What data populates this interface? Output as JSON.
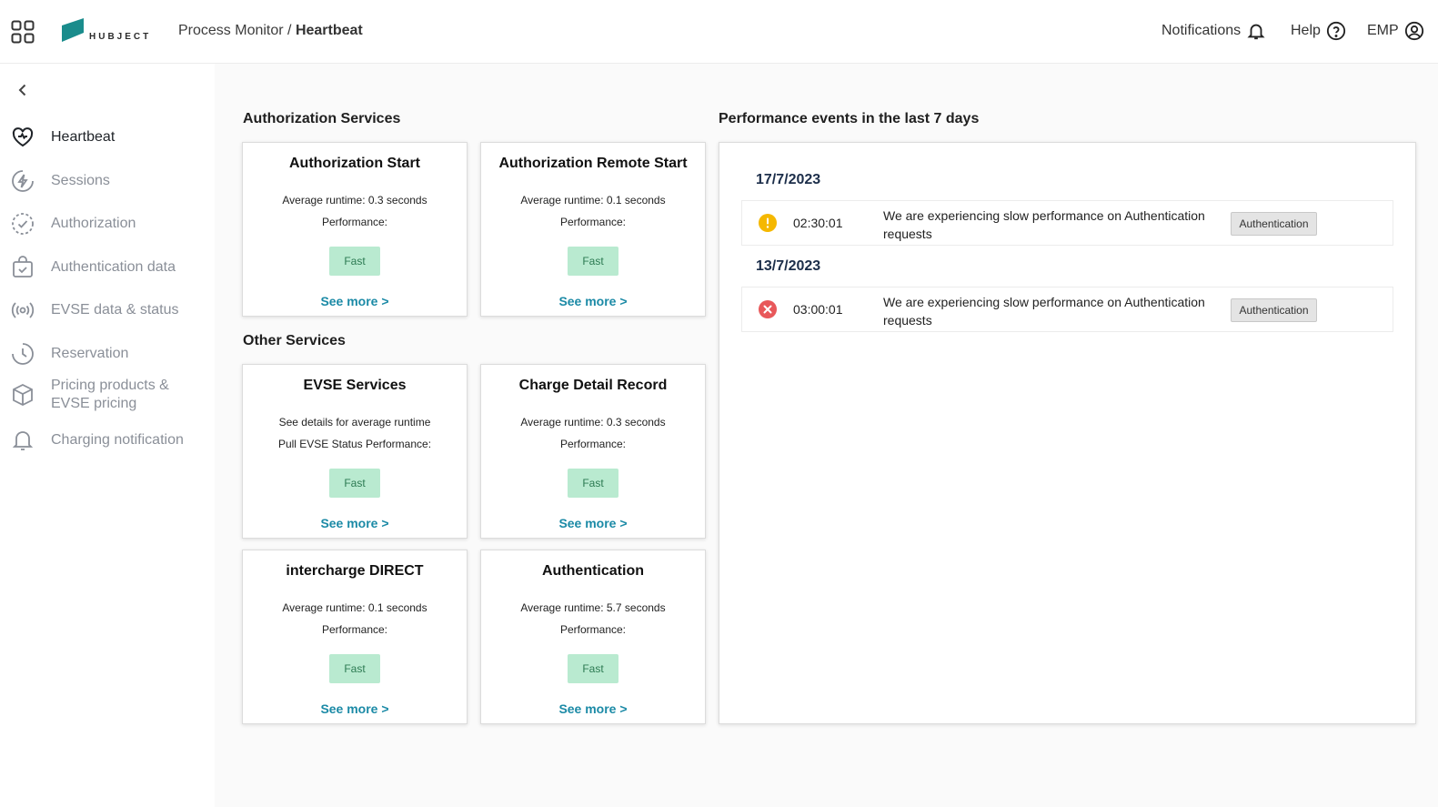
{
  "header": {
    "logo_text": "HUBJECT",
    "breadcrumb_parent": "Process Monitor / ",
    "breadcrumb_current": "Heartbeat",
    "notifications_label": "Notifications",
    "help_label": "Help",
    "account_label": "EMP"
  },
  "sidebar": {
    "items": [
      {
        "label": "Heartbeat",
        "icon": "heart-icon"
      },
      {
        "label": "Sessions",
        "icon": "bolt-icon"
      },
      {
        "label": "Authorization",
        "icon": "check-circle-icon"
      },
      {
        "label": "Authentication data",
        "icon": "bag-check-icon"
      },
      {
        "label": "EVSE data & status",
        "icon": "broadcast-icon"
      },
      {
        "label": "Reservation",
        "icon": "clock-icon"
      },
      {
        "label": "Pricing products &",
        "label2": "EVSE pricing",
        "icon": "box-icon"
      },
      {
        "label": "Charging notification",
        "icon": "bell-icon"
      }
    ]
  },
  "sections": {
    "authorization_title": "Authorization Services",
    "other_title": "Other Services",
    "events_title": "Performance events in the last 7 days"
  },
  "cards": [
    {
      "title": "Authorization Start",
      "line1": "Average runtime: 0.3 seconds",
      "line2": "Performance:",
      "status": "Fast",
      "link": "See more >"
    },
    {
      "title": "Authorization Remote Start",
      "line1": "Average runtime: 0.1 seconds",
      "line2": "Performance:",
      "status": "Fast",
      "link": "See more >"
    },
    {
      "title": "EVSE Services",
      "line1": "See details for average runtime",
      "line2": "Pull EVSE Status Performance:",
      "status": "Fast",
      "link": "See more >"
    },
    {
      "title": "Charge Detail Record",
      "line1": "Average runtime: 0.3 seconds",
      "line2": "Performance:",
      "status": "Fast",
      "link": "See more >"
    },
    {
      "title": "intercharge DIRECT",
      "line1": "Average runtime: 0.1 seconds",
      "line2": "Performance:",
      "status": "Fast",
      "link": "See more >"
    },
    {
      "title": "Authentication",
      "line1": "Average runtime: 5.7 seconds",
      "line2": "Performance:",
      "status": "Fast",
      "link": "See more >"
    }
  ],
  "events": [
    {
      "date": "17/7/2023",
      "severity": "warning",
      "time": "02:30:01",
      "message": "We are experiencing slow performance on Authentication requests",
      "tag": "Authentication"
    },
    {
      "date": "13/7/2023",
      "severity": "error",
      "time": "03:00:01",
      "message": "We are experiencing slow performance on Authentication requests",
      "tag": "Authentication"
    }
  ],
  "colors": {
    "accent": "#1b8aa6",
    "fast_badge_bg": "#b9ead0",
    "warning": "#f5b800",
    "error": "#e8585a",
    "logo": "#1a8c8c"
  }
}
